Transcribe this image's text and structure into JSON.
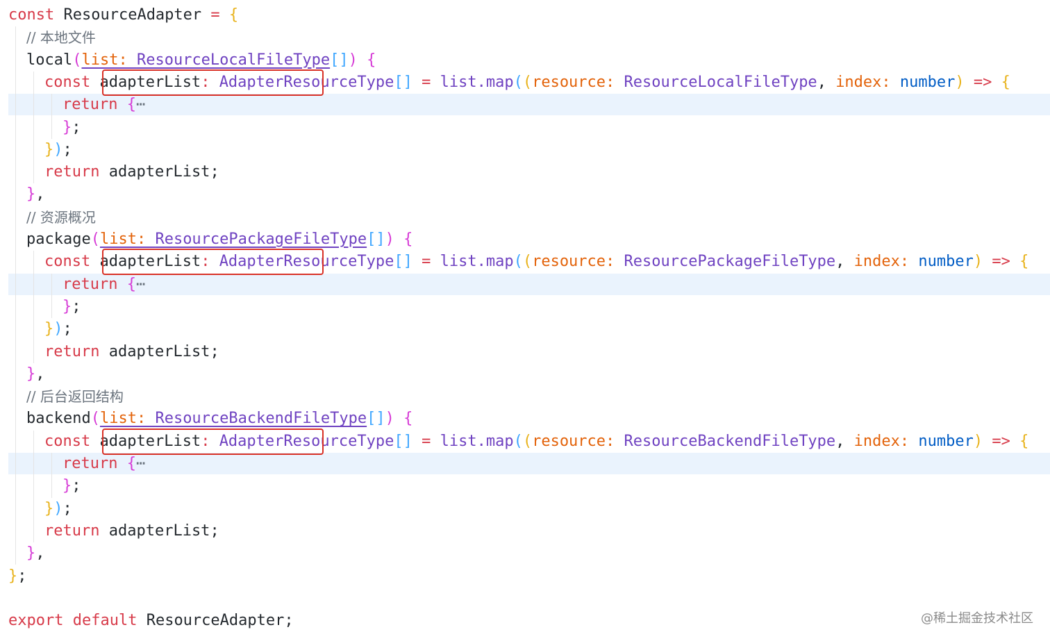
{
  "code": {
    "object_name": "ResourceAdapter",
    "kw_const": "const",
    "kw_return": "return",
    "kw_export": "export",
    "kw_default": "default",
    "param_list": "list",
    "param_resource": "resource",
    "param_index": "index",
    "type_number": "number",
    "adapter_var": "adapterList",
    "adapter_type": "AdapterResourceType",
    "map_call": "list.map",
    "arrow": "=>",
    "ellipsis": "⋯",
    "blocks": [
      {
        "comment": "// 本地文件",
        "method": "local",
        "param_type": "ResourceLocalFileType",
        "resource_type": "ResourceLocalFileType"
      },
      {
        "comment": "// 资源概况",
        "method": "package",
        "param_type": "ResourcePackageFileType",
        "resource_type": "ResourcePackageFileType"
      },
      {
        "comment": "// 后台返回结构",
        "method": "backend",
        "param_type": "ResourceBackendFileType",
        "resource_type": "ResourceBackendFileType"
      }
    ]
  },
  "watermark": "@稀土掘金技术社区"
}
